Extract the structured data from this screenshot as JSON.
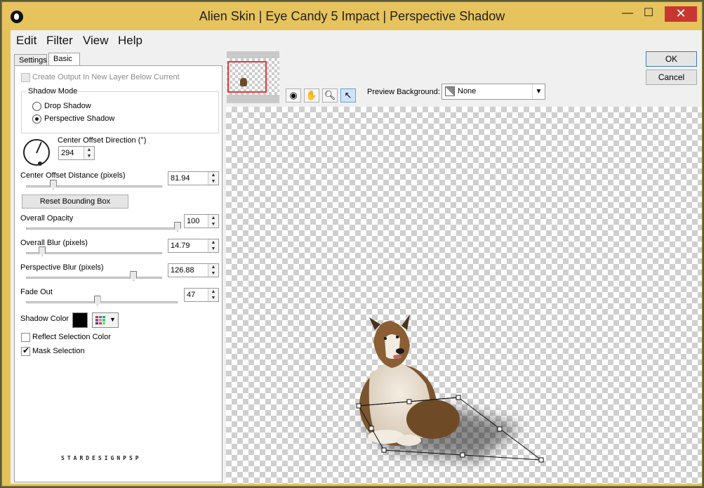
{
  "window": {
    "title": "Alien Skin | Eye Candy 5 Impact | Perspective Shadow",
    "controls": {
      "minimize": "—",
      "maximize": "☐",
      "close": "✕"
    }
  },
  "menu": [
    "Edit",
    "Filter",
    "View",
    "Help"
  ],
  "tabs": {
    "settings": "Settings",
    "basic": "Basic"
  },
  "basic": {
    "create_output": {
      "label": "Create Output In New Layer Below Current",
      "checked": false,
      "enabled": false
    },
    "shadow_mode": {
      "title": "Shadow Mode",
      "options": [
        {
          "label": "Drop Shadow",
          "selected": false
        },
        {
          "label": "Perspective Shadow",
          "selected": true
        }
      ]
    },
    "center_offset_direction": {
      "label": "Center Offset Direction (°)",
      "value": "294"
    },
    "center_offset_distance": {
      "label": "Center Offset Distance (pixels)",
      "value": "81.94",
      "slider": 0.2
    },
    "reset_bounding_box": "Reset Bounding Box",
    "overall_opacity": {
      "label": "Overall Opacity",
      "value": "100",
      "slider": 1.0
    },
    "overall_blur": {
      "label": "Overall Blur (pixels)",
      "value": "14.79",
      "slider": 0.12
    },
    "perspective_blur": {
      "label": "Perspective Blur (pixels)",
      "value": "126.88",
      "slider": 0.79
    },
    "fade_out": {
      "label": "Fade Out",
      "value": "47",
      "slider": 0.47
    },
    "shadow_color": {
      "label": "Shadow Color",
      "color": "#000000"
    },
    "reflect_selection_color": {
      "label": "Reflect Selection Color",
      "checked": false
    },
    "mask_selection": {
      "label": "Mask Selection",
      "checked": true
    },
    "watermark": "STARDESIGNPSP"
  },
  "toolbar": {
    "tools": [
      "zoom-eye-icon",
      "hand-icon",
      "zoom-icon",
      "pointer-icon"
    ],
    "preview_background_label": "Preview Background:",
    "preview_background_value": "None"
  },
  "buttons": {
    "ok": "OK",
    "cancel": "Cancel"
  },
  "colors": {
    "title_bar": "#e6c35c",
    "close_button": "#c7372f",
    "nav_frame": "#e23b3b"
  }
}
